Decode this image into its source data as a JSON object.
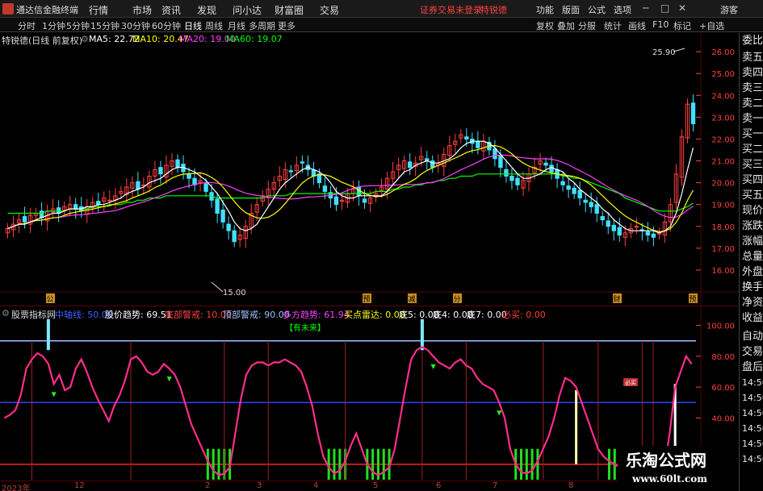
{
  "titlebar": {
    "app_title": "通达信金融终端",
    "menus": [
      "行情",
      "市场",
      "资讯",
      "发现",
      "问小达",
      "财富圈",
      "交易"
    ],
    "login_status": "证券交易未登录",
    "stock_name": "特锐德",
    "right_menus": [
      "功能",
      "版面",
      "公式",
      "选项"
    ],
    "guest": "游客"
  },
  "period_tabs": [
    "分时",
    "1分钟",
    "5分钟",
    "15分钟",
    "30分钟",
    "60分钟",
    "日线",
    "周线",
    "月线",
    "多周期",
    "更多"
  ],
  "active_period": "日线",
  "right_tabs": [
    "复权",
    "叠加",
    "分服",
    "统计",
    "画线",
    "F10",
    "标记",
    "+自选"
  ],
  "main_header": {
    "title": "特锐德(日线 前复权)",
    "ma5": "MA5: 22.72",
    "ma10": "MA10: 20.47",
    "ma20": "MA20: 19.00",
    "ma60": "MA60: 19.07"
  },
  "colors": {
    "ma5": "#ffffff",
    "ma10": "#ffff00",
    "ma20": "#ff40ff",
    "ma60": "#00ff00",
    "up": "#ff4040",
    "down": "#40e0ff",
    "indicator_line": "#ff2d8a",
    "axis_text": "#ff4040"
  },
  "price_axis": [
    "26.00",
    "25.00",
    "24.00",
    "23.00",
    "22.00",
    "21.00",
    "20.00",
    "19.00",
    "18.00",
    "17.00",
    "16.00"
  ],
  "price_annotations": {
    "high": "25.90",
    "low": "15.00"
  },
  "event_markers": [
    "公",
    "预",
    "减",
    "分",
    "财",
    "预"
  ],
  "indicator_header": {
    "name": "股票指标网",
    "center_line": "中轴线: 50.00",
    "price_trend": "股价趋势: 69.51",
    "bottom_warning": "底部警戒: 10.00",
    "top_warning": "顶部警戒: 90.00",
    "bull_trend": "多方趋势: 61.94",
    "buy_radar": "买点雷达: 0.00",
    "bottom5": "底5: 0.00",
    "bottom4": "底4: 0.00",
    "bottom7": "底7: 0.00",
    "must_buy": "必买: 0.00"
  },
  "indicator_axis": [
    "100.00",
    "80.00",
    "60.00",
    "40.00"
  ],
  "indicator_label": "【有未来】",
  "indicator_tag": "必买",
  "date_axis": [
    "2023年",
    "12",
    "2",
    "3",
    "4",
    "5",
    "6",
    "7",
    "8"
  ],
  "side_panel": [
    "委比",
    "卖五",
    "卖四",
    "卖三",
    "卖二",
    "卖一",
    "买一",
    "买二",
    "买三",
    "买四",
    "买五",
    "现价",
    "涨跌",
    "涨幅",
    "总量",
    "外盘",
    "换手",
    "净资",
    "收益",
    "自动",
    "交易",
    "盘后",
    "14:56",
    "14:56",
    "14:56",
    "14:56",
    "14:56",
    "14:56"
  ],
  "watermark": {
    "title": "乐淘公式网",
    "url": "www.60lt.com"
  },
  "chart_data": {
    "type": "candlestick",
    "title": "特锐德(日线 前复权)",
    "ylim": [
      15.0,
      26.3
    ],
    "close": [
      17.9,
      18.1,
      18.3,
      18.2,
      18.5,
      18.6,
      18.4,
      18.7,
      18.8,
      18.6,
      18.9,
      19.0,
      18.8,
      18.7,
      18.9,
      19.1,
      19.0,
      19.3,
      19.2,
      19.4,
      19.6,
      19.8,
      20.0,
      19.7,
      19.9,
      20.3,
      20.6,
      20.4,
      20.8,
      21.0,
      20.7,
      20.5,
      20.2,
      19.9,
      20.1,
      19.6,
      19.2,
      18.6,
      18.2,
      17.8,
      17.3,
      17.6,
      18.0,
      18.6,
      19.0,
      19.4,
      19.7,
      20.0,
      20.3,
      20.6,
      20.5,
      20.8,
      20.9,
      20.6,
      20.3,
      20.0,
      19.6,
      19.3,
      19.0,
      19.2,
      19.5,
      19.7,
      19.4,
      19.1,
      19.3,
      19.5,
      19.8,
      20.2,
      20.5,
      20.8,
      21.0,
      20.7,
      20.9,
      21.2,
      21.0,
      20.7,
      20.9,
      21.3,
      21.7,
      21.9,
      22.2,
      22.0,
      21.8,
      21.6,
      21.9,
      21.5,
      21.1,
      20.7,
      20.3,
      20.1,
      19.9,
      20.1,
      20.4,
      20.7,
      21.0,
      20.8,
      20.5,
      20.2,
      19.9,
      19.7,
      19.5,
      19.3,
      19.1,
      18.9,
      18.6,
      18.3,
      18.0,
      17.8,
      17.6,
      17.7,
      17.9,
      18.0,
      17.8,
      17.6,
      17.5,
      17.7,
      18.2,
      19.0,
      20.4,
      22.1,
      23.6,
      22.7
    ],
    "ma5": [
      17.9,
      18.0,
      18.1,
      18.1,
      18.2,
      18.3,
      18.4,
      18.5,
      18.6,
      18.6,
      18.7,
      18.8,
      18.8,
      18.8,
      18.9,
      18.9,
      19.0,
      19.0,
      19.1,
      19.2,
      19.3,
      19.5,
      19.6,
      19.7,
      19.8,
      20.0,
      20.1,
      20.2,
      20.4,
      20.6,
      20.7,
      20.7,
      20.6,
      20.5,
      20.3,
      20.1,
      19.8,
      19.5,
      19.1,
      18.7,
      18.2,
      17.9,
      17.8,
      17.9,
      18.1,
      18.5,
      18.9,
      19.3,
      19.7,
      20.0,
      20.2,
      20.4,
      20.6,
      20.7,
      20.6,
      20.5,
      20.3,
      20.0,
      19.6,
      19.4,
      19.3,
      19.3,
      19.4,
      19.4,
      19.4,
      19.4,
      19.4,
      19.6,
      19.9,
      20.2,
      20.5,
      20.6,
      20.8,
      20.9,
      21.0,
      20.9,
      20.9,
      21.0,
      21.1,
      21.3,
      21.6,
      21.8,
      21.9,
      21.9,
      21.9,
      21.8,
      21.6,
      21.3,
      21.0,
      20.7,
      20.4,
      20.2,
      20.2,
      20.3,
      20.4,
      20.6,
      20.7,
      20.6,
      20.5,
      20.2,
      20.0,
      19.7,
      19.5,
      19.3,
      19.1,
      18.8,
      18.6,
      18.3,
      18.1,
      17.9,
      17.8,
      17.8,
      17.8,
      17.8,
      17.8,
      17.7,
      17.8,
      18.0,
      18.6,
      19.5,
      20.6,
      21.6
    ],
    "ma60": [
      18.6,
      18.6,
      18.6,
      18.6,
      18.6,
      18.6,
      18.6,
      18.7,
      18.7,
      18.7,
      18.7,
      18.8,
      18.8,
      18.8,
      18.8,
      18.9,
      18.9,
      18.9,
      19.0,
      19.0,
      19.0,
      19.1,
      19.1,
      19.2,
      19.2,
      19.3,
      19.3,
      19.3,
      19.4,
      19.4,
      19.4,
      19.4,
      19.4,
      19.4,
      19.4,
      19.4,
      19.4,
      19.3,
      19.3,
      19.3,
      19.3,
      19.3,
      19.3,
      19.3,
      19.3,
      19.3,
      19.4,
      19.4,
      19.4,
      19.4,
      19.5,
      19.5,
      19.5,
      19.5,
      19.5,
      19.5,
      19.5,
      19.5,
      19.5,
      19.5,
      19.5,
      19.5,
      19.5,
      19.5,
      19.5,
      19.6,
      19.6,
      19.6,
      19.7,
      19.7,
      19.8,
      19.8,
      19.9,
      19.9,
      20.0,
      20.0,
      20.1,
      20.1,
      20.2,
      20.2,
      20.3,
      20.3,
      20.3,
      20.4,
      20.4,
      20.4,
      20.4,
      20.4,
      20.4,
      20.4,
      20.4,
      20.4,
      20.4,
      20.4,
      20.4,
      20.4,
      20.4,
      20.4,
      20.3,
      20.3,
      20.2,
      20.2,
      20.1,
      20.0,
      19.9,
      19.8,
      19.7,
      19.6,
      19.5,
      19.3,
      19.2,
      19.1,
      19.0,
      18.9,
      18.8,
      18.7,
      18.7,
      18.7,
      18.7,
      18.8,
      18.9,
      19.07
    ],
    "indicator": {
      "ylim": [
        0,
        105
      ],
      "top_warning": 90,
      "center_line": 50,
      "bottom_warning": 10,
      "price_trend": [
        40,
        42,
        45,
        55,
        72,
        78,
        82,
        80,
        75,
        62,
        68,
        58,
        60,
        72,
        78,
        70,
        60,
        52,
        45,
        38,
        48,
        55,
        65,
        78,
        80,
        76,
        70,
        68,
        70,
        75,
        72,
        68,
        60,
        48,
        36,
        28,
        20,
        12,
        6,
        3,
        4,
        8,
        30,
        52,
        68,
        74,
        76,
        76,
        74,
        76,
        76,
        78,
        76,
        74,
        70,
        60,
        48,
        30,
        15,
        8,
        4,
        6,
        12,
        22,
        30,
        20,
        10,
        5,
        3,
        5,
        8,
        20,
        40,
        60,
        78,
        84,
        86,
        84,
        80,
        76,
        74,
        72,
        76,
        78,
        74,
        72,
        66,
        62,
        60,
        58,
        50,
        40,
        20,
        10,
        5,
        4,
        6,
        12,
        20,
        28,
        40,
        55,
        66,
        64,
        60,
        50,
        40,
        30,
        20,
        15,
        12,
        10,
        8,
        6,
        8,
        12,
        16,
        14,
        10,
        8,
        6,
        30,
        60,
        70,
        80,
        75
      ]
    }
  }
}
